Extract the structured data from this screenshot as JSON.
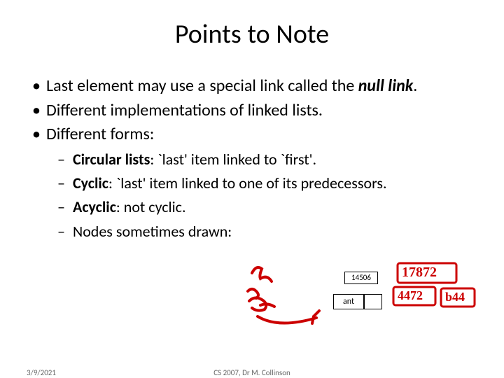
{
  "title": "Points to Note",
  "bullets": {
    "b1_pre": "Last element may use a special link called the ",
    "b1_em": "null link",
    "b1_post": ".",
    "b2": "Different implementations of linked lists.",
    "b3": "Different forms:"
  },
  "sub": {
    "s1_label": "Circular lists",
    "s1_rest": ": `last' item linked to `first'.",
    "s2_label": "Cyclic",
    "s2_rest": ": `last' item linked to one of its predecessors.",
    "s3_label": "Acyclic",
    "s3_rest": ": not cyclic.",
    "s4": "Nodes sometimes drawn:"
  },
  "diagram": {
    "top_value": "14506",
    "bottom_value": "ant"
  },
  "handwriting": {
    "top_right": "17872",
    "mid_right": "4472",
    "bot_right": "b44"
  },
  "footer": {
    "date": "3/9/2021",
    "center": "CS 2007,  Dr M. Collinson"
  }
}
